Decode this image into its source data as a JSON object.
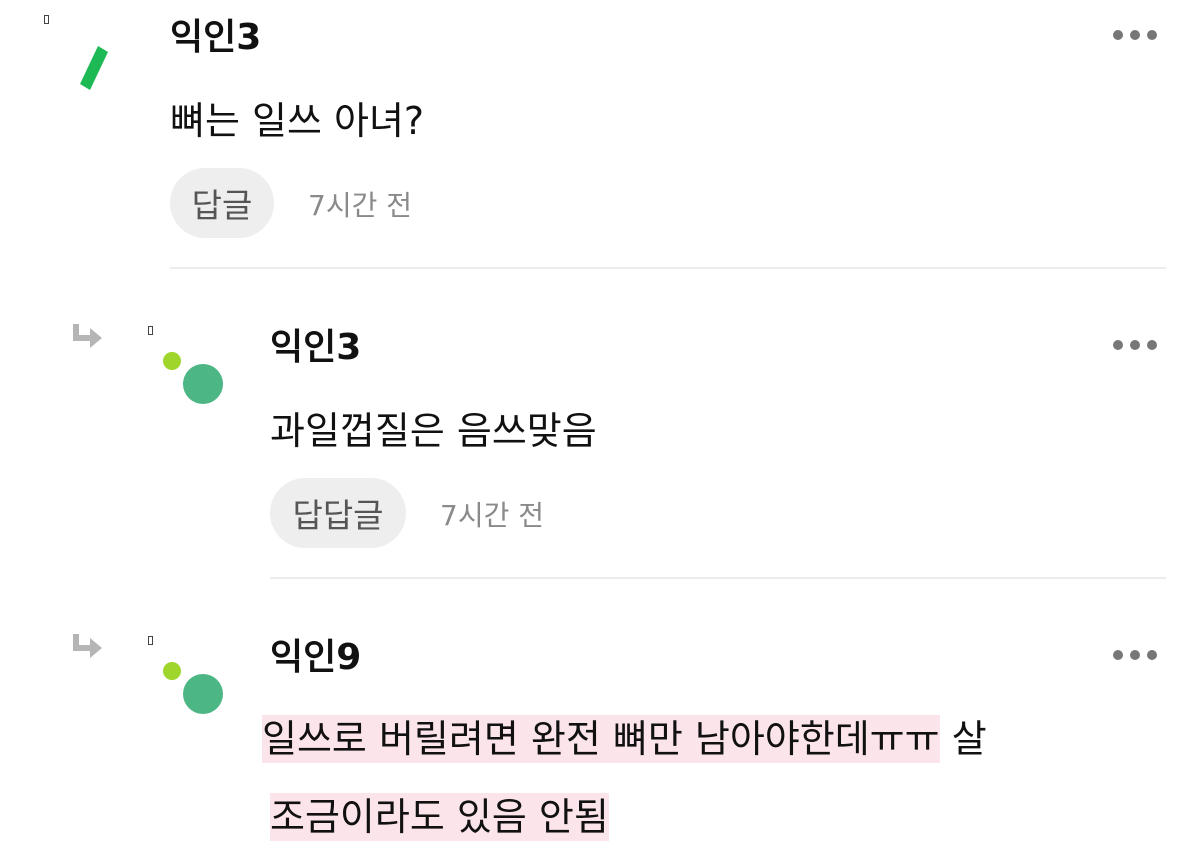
{
  "comments": [
    {
      "username": "익인3",
      "text": "뼈는 일쓰 아녀?",
      "reply_label": "답글",
      "time": "7시간 전",
      "avatar_color": "#1db954"
    },
    {
      "username": "익인3",
      "text": "과일껍질은 음쓰맞음",
      "reply_label": "답답글",
      "time": "7시간 전",
      "avatar_small_color": "#9fd62b",
      "avatar_big_color": "#4cb684"
    },
    {
      "username": "익인9",
      "text_line1_highlighted": "일쓰로 버릴려면 완전 뼈만 남아야한데ㅠㅠ",
      "text_line1_plain": " 살",
      "text_line2_highlighted": "조금이라도 있음 안됨",
      "highlight_color": "#fbe4ea",
      "avatar_small_color": "#9fd62b",
      "avatar_big_color": "#4cb684"
    }
  ]
}
